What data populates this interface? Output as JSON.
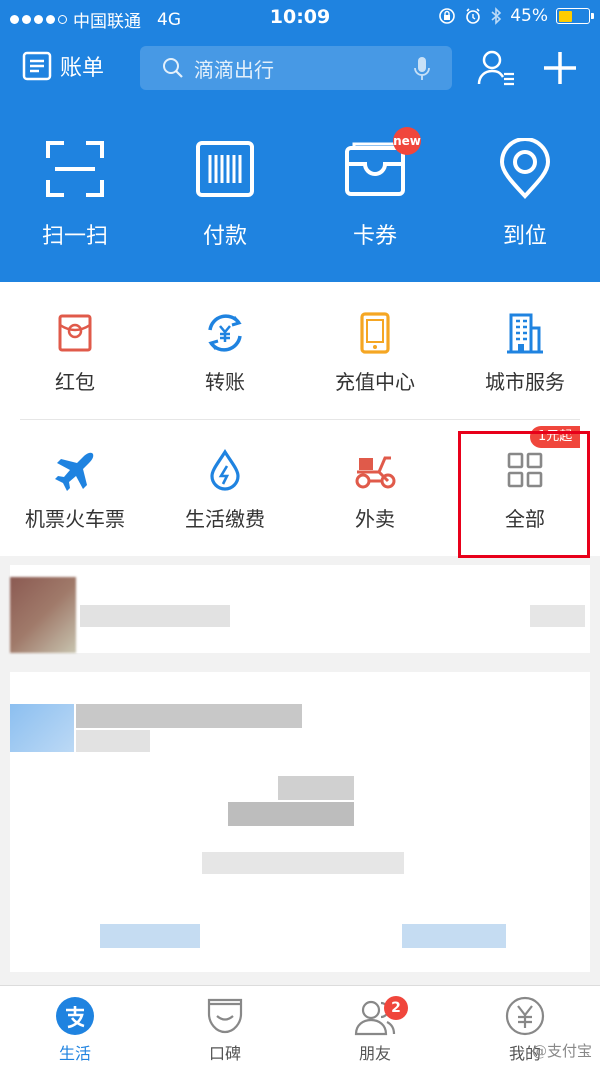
{
  "status_bar": {
    "carrier": "中国联通",
    "network": "4G",
    "time": "10:09",
    "battery": "45%"
  },
  "top_bar": {
    "bill_label": "账单",
    "search_placeholder": "滴滴出行"
  },
  "quick_actions": [
    {
      "label": "扫一扫",
      "icon": "scan-icon"
    },
    {
      "label": "付款",
      "icon": "barcode-icon"
    },
    {
      "label": "卡券",
      "icon": "wallet-icon",
      "badge": "new"
    },
    {
      "label": "到位",
      "icon": "location-icon"
    }
  ],
  "services_row1": [
    {
      "label": "红包",
      "icon": "red-envelope-icon",
      "color": "#e05a4a"
    },
    {
      "label": "转账",
      "icon": "transfer-icon",
      "color": "#1f83e0"
    },
    {
      "label": "充值中心",
      "icon": "phone-icon",
      "color": "#f5a623"
    },
    {
      "label": "城市服务",
      "icon": "building-icon",
      "color": "#1f83e0"
    }
  ],
  "services_row2": [
    {
      "label": "机票火车票",
      "icon": "plane-icon",
      "color": "#1f83e0"
    },
    {
      "label": "生活缴费",
      "icon": "water-drop-icon",
      "color": "#1f83e0"
    },
    {
      "label": "外卖",
      "icon": "scooter-icon",
      "color": "#e05a4a"
    },
    {
      "label": "全部",
      "icon": "grid-icon",
      "color": "#888888"
    }
  ],
  "promo_tag": "1元起",
  "tab_bar": [
    {
      "label": "生活",
      "icon": "alipay-icon",
      "active": true
    },
    {
      "label": "口碑",
      "icon": "koubei-icon",
      "active": false
    },
    {
      "label": "朋友",
      "icon": "friends-icon",
      "active": false,
      "badge": "2"
    },
    {
      "label": "我的",
      "icon": "yuan-icon",
      "active": false
    }
  ],
  "watermark": "@支付宝",
  "colors": {
    "brand_blue": "#1f83e0",
    "badge_red": "#f0463c",
    "highlight_red": "#e8001a"
  }
}
